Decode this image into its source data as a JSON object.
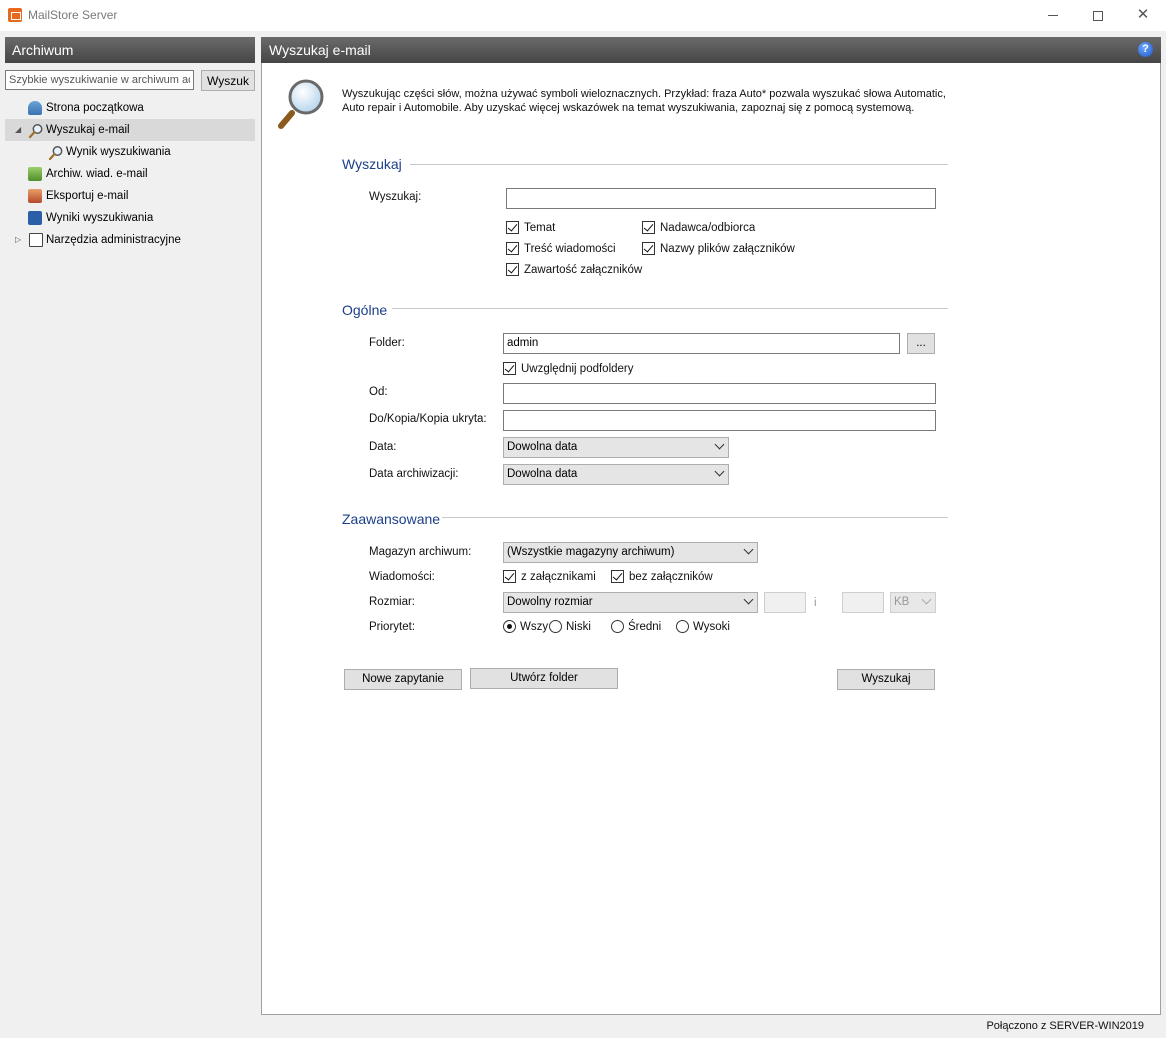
{
  "window": {
    "title": "MailStore Server"
  },
  "sidebar": {
    "header": "Archiwum",
    "quick_search_placeholder": "Szybkie wyszukiwanie w archiwum adm",
    "quick_search_button": "Wyszuk",
    "items": [
      {
        "label": "Strona początkowa",
        "icon": "home-icon"
      },
      {
        "label": "Wyszukaj e-mail",
        "icon": "magnifier-icon",
        "expanded": true,
        "selected": true
      },
      {
        "label": "Wynik wyszukiwania",
        "icon": "magnifier-icon",
        "child": true
      },
      {
        "label": "Archiw. wiad. e-mail",
        "icon": "archive-icon"
      },
      {
        "label": "Eksportuj e-mail",
        "icon": "export-icon"
      },
      {
        "label": "Wyniki wyszukiwania",
        "icon": "results-icon"
      },
      {
        "label": "Narzędzia administracyjne",
        "icon": "tools-icon",
        "expanded": false
      }
    ]
  },
  "main": {
    "header": "Wyszukaj e-mail",
    "intro_line1": "Wyszukując części słów, można używać symboli wieloznacznych. Przykład: fraza Auto* pozwala wyszukać słowa Automatic,",
    "intro_line2": "Auto repair i Automobile. Aby uzyskać więcej wskazówek na temat wyszukiwania, zapoznaj się z pomocą systemową.",
    "search_section": {
      "title": "Wyszukaj",
      "search_label": "Wyszukaj:",
      "search_value": "",
      "checkboxes": {
        "subject": "Temat",
        "sender": "Nadawca/odbiorca",
        "body": "Treść wiadomości",
        "attachment_names": "Nazwy plików załączników",
        "attachment_content": "Zawartość załączników"
      }
    },
    "general_section": {
      "title": "Ogólne",
      "folder_label": "Folder:",
      "folder_value": "admin",
      "browse_button": "...",
      "include_subfolders": "Uwzględnij podfoldery",
      "from_label": "Od:",
      "from_value": "",
      "to_label": "Do/Kopia/Kopia ukryta:",
      "to_value": "",
      "date_label": "Data:",
      "date_value": "Dowolna data",
      "archive_date_label": "Data archiwizacji:",
      "archive_date_value": "Dowolna data"
    },
    "advanced_section": {
      "title": "Zaawansowane",
      "store_label": "Magazyn archiwum:",
      "store_value": "(Wszystkie magazyny archiwum)",
      "messages_label": "Wiadomości:",
      "with_attachments": "z załącznikami",
      "without_attachments": "bez załączników",
      "size_label": "Rozmiar:",
      "size_value": "Dowolny rozmiar",
      "size_and": "i",
      "size_unit": "KB",
      "priority_label": "Priorytet:",
      "priority_options": [
        "Wszy",
        "Niski",
        "Średni",
        "Wysoki"
      ],
      "priority_selected": "Wszy"
    },
    "buttons": {
      "new_query": "Nowe zapytanie",
      "create_folder": "Utwórz folder",
      "search": "Wyszukaj"
    }
  },
  "status": {
    "text": "Połączono z SERVER-WIN2019"
  }
}
